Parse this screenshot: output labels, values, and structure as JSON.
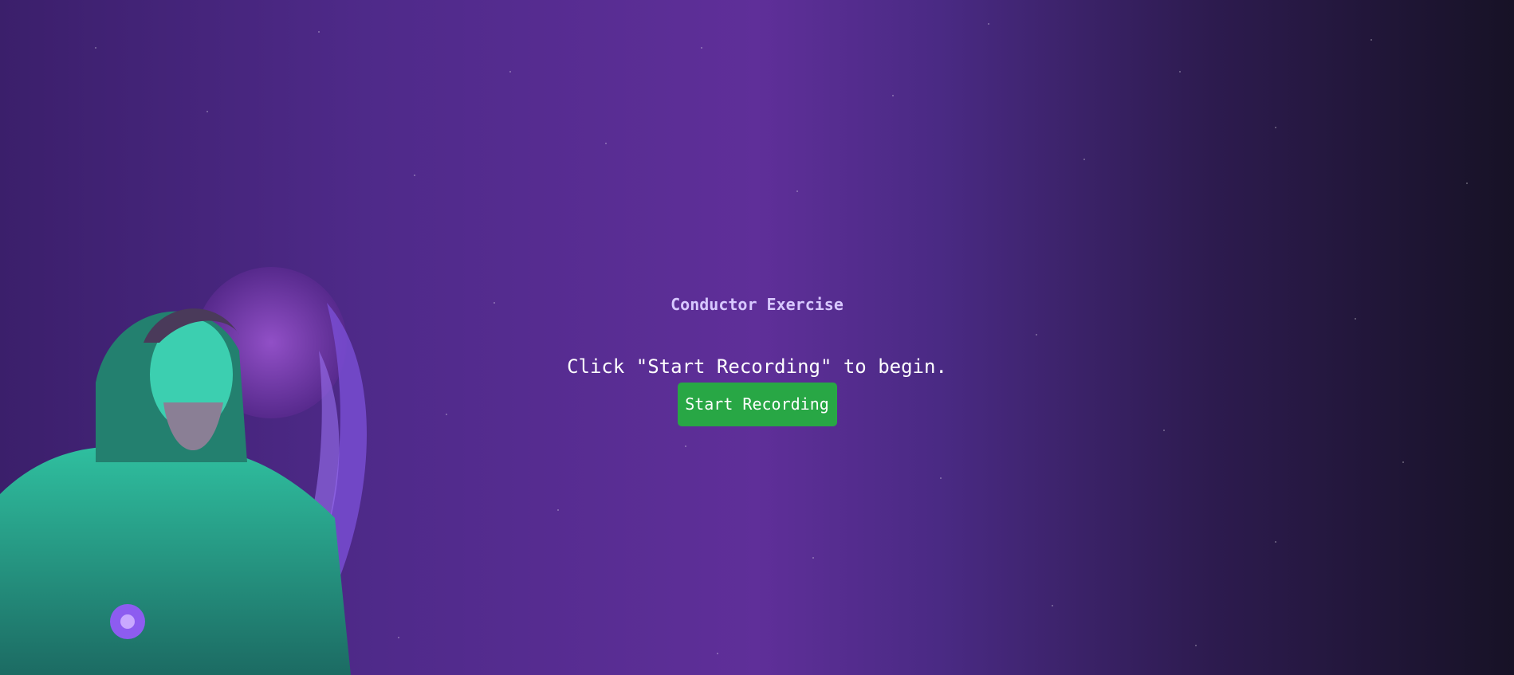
{
  "page": {
    "title": "Conductor Exercise",
    "instruction": "Click \"Start Recording\" to begin.",
    "start_button_label": "Start Recording"
  },
  "colors": {
    "background_center": "#5f2f99",
    "background_edge": "#171226",
    "title_text": "#d8c8ff",
    "button_bg": "#28a745",
    "button_text": "#ffffff",
    "illustration_accent": "#2fd1b0"
  },
  "icons": {
    "illustration": "wizard-illustration"
  }
}
